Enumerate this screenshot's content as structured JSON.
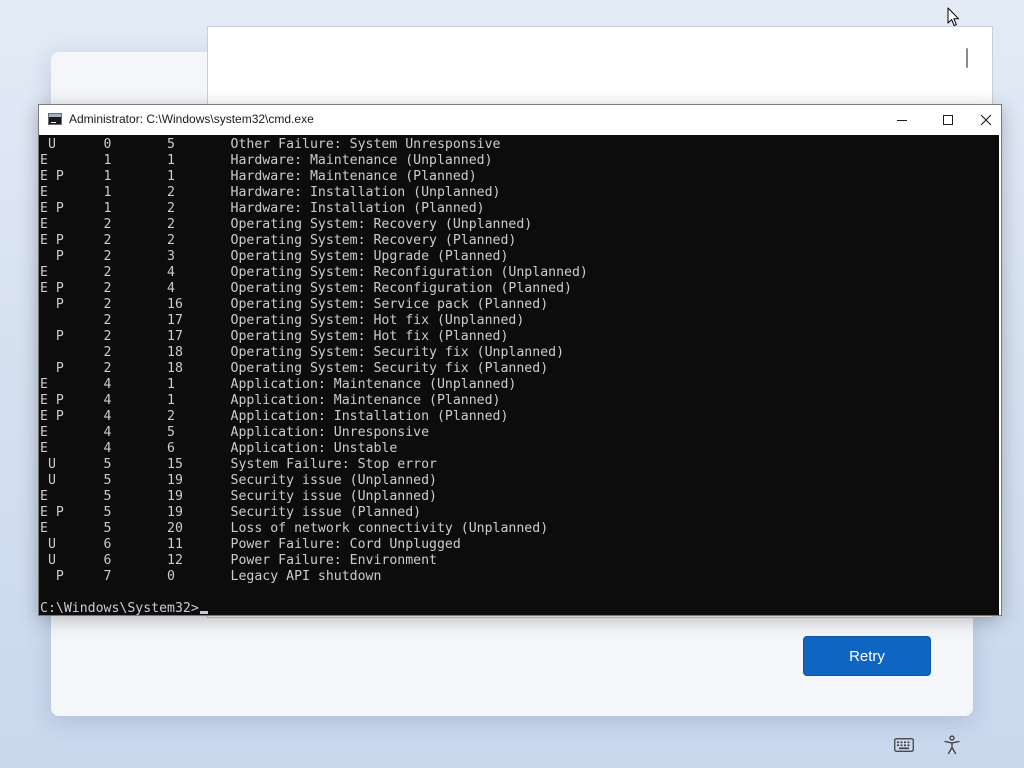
{
  "window": {
    "title": "Administrator: C:\\Windows\\system32\\cmd.exe"
  },
  "terminal": {
    "lines": [
      " U      0       5       Other Failure: System Unresponsive",
      "E       1       1       Hardware: Maintenance (Unplanned)",
      "E P     1       1       Hardware: Maintenance (Planned)",
      "E       1       2       Hardware: Installation (Unplanned)",
      "E P     1       2       Hardware: Installation (Planned)",
      "E       2       2       Operating System: Recovery (Unplanned)",
      "E P     2       2       Operating System: Recovery (Planned)",
      "  P     2       3       Operating System: Upgrade (Planned)",
      "E       2       4       Operating System: Reconfiguration (Unplanned)",
      "E P     2       4       Operating System: Reconfiguration (Planned)",
      "  P     2       16      Operating System: Service pack (Planned)",
      "        2       17      Operating System: Hot fix (Unplanned)",
      "  P     2       17      Operating System: Hot fix (Planned)",
      "        2       18      Operating System: Security fix (Unplanned)",
      "  P     2       18      Operating System: Security fix (Planned)",
      "E       4       1       Application: Maintenance (Unplanned)",
      "E P     4       1       Application: Maintenance (Planned)",
      "E P     4       2       Application: Installation (Planned)",
      "E       4       5       Application: Unresponsive",
      "E       4       6       Application: Unstable",
      " U      5       15      System Failure: Stop error",
      " U      5       19      Security issue (Unplanned)",
      "E       5       19      Security issue (Unplanned)",
      "E P     5       19      Security issue (Planned)",
      "E       5       20      Loss of network connectivity (Unplanned)",
      " U      6       11      Power Failure: Cord Unplugged",
      " U      6       12      Power Failure: Environment",
      "  P     7       0       Legacy API shutdown",
      ""
    ],
    "prompt": "C:\\Windows\\System32>"
  },
  "setup": {
    "retry_label": "Retry"
  },
  "icons": {
    "cmd": "cmd-icon",
    "minimize": "minimize-icon",
    "maximize": "maximize-icon",
    "close": "close-icon",
    "keyboard": "keyboard-icon",
    "accessibility": "accessibility-icon",
    "cursor": "mouse-cursor-icon"
  },
  "colors": {
    "terminal_bg": "#0c0c0c",
    "terminal_fg": "#cccccc",
    "accent": "#0f66c2"
  }
}
